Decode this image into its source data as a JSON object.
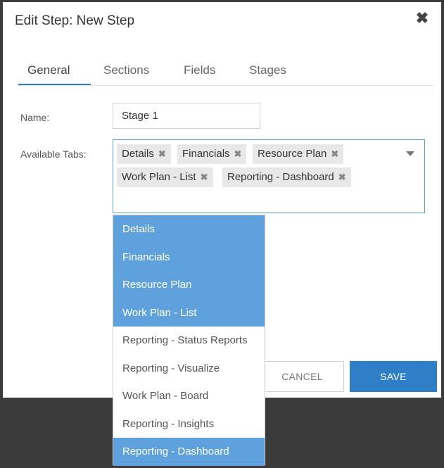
{
  "dialog": {
    "title": "Edit Step: New Step",
    "close_icon": "close-icon"
  },
  "tabs": [
    {
      "label": "General",
      "active": true
    },
    {
      "label": "Sections",
      "active": false
    },
    {
      "label": "Fields",
      "active": false
    },
    {
      "label": "Stages",
      "active": false
    }
  ],
  "form": {
    "name_label": "Name:",
    "name_value": "Stage 1",
    "tabs_label": "Available Tabs:",
    "chips": [
      "Details",
      "Financials",
      "Resource Plan",
      "Work Plan - List",
      "Reporting - Dashboard"
    ],
    "chip_remove_glyph": "✖"
  },
  "dropdown": {
    "options": [
      {
        "label": "Details",
        "selected": true
      },
      {
        "label": "Financials",
        "selected": true
      },
      {
        "label": "Resource Plan",
        "selected": true
      },
      {
        "label": "Work Plan - List",
        "selected": true
      },
      {
        "label": "Reporting - Status Reports",
        "selected": false
      },
      {
        "label": "Reporting - Visualize",
        "selected": false
      },
      {
        "label": "Work Plan - Board",
        "selected": false
      },
      {
        "label": "Reporting - Insights",
        "selected": false
      },
      {
        "label": "Reporting - Dashboard",
        "selected": true
      }
    ]
  },
  "buttons": {
    "cancel": "CANCEL",
    "save": "SAVE"
  },
  "colors": {
    "accent": "#2f7fc8",
    "selected_option": "#5fa1dc",
    "overlay": "#3b3b3b"
  }
}
